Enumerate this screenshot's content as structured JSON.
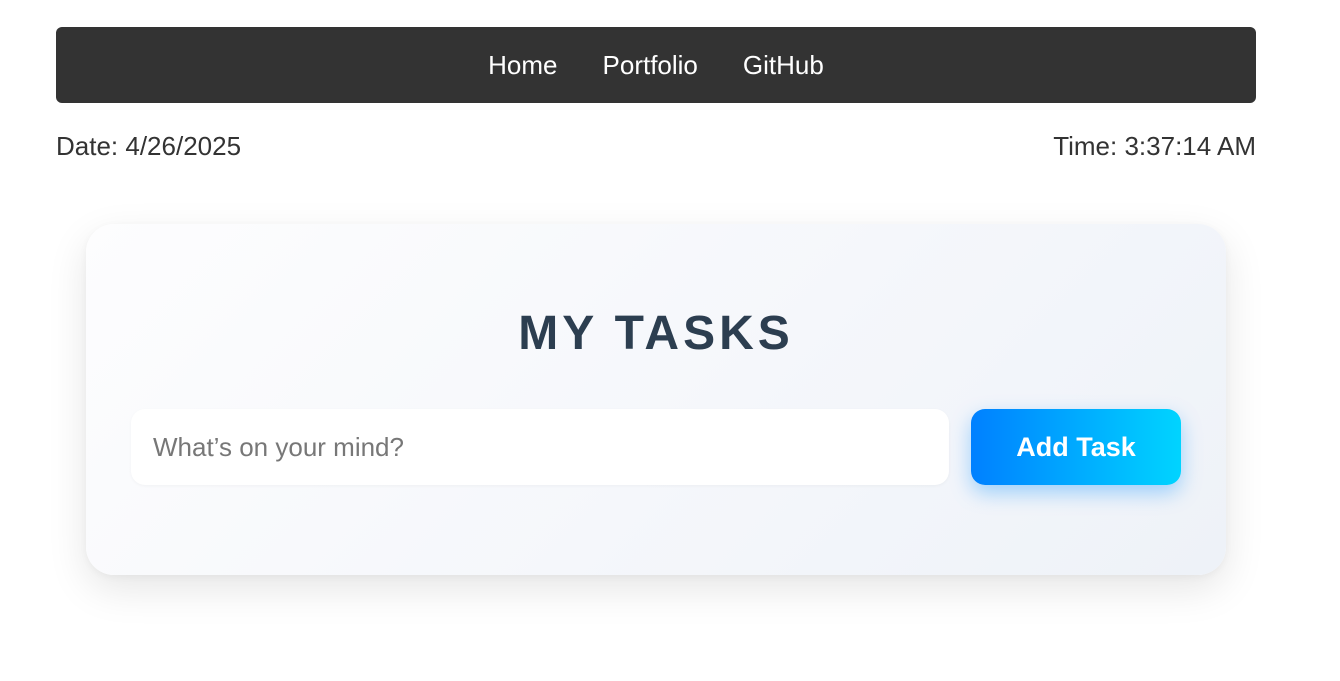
{
  "nav": {
    "links": [
      {
        "label": "Home"
      },
      {
        "label": "Portfolio"
      },
      {
        "label": "GitHub"
      }
    ]
  },
  "info": {
    "date_text": "Date: 4/26/2025",
    "time_text": "Time: 3:37:14 AM"
  },
  "card": {
    "title": "MY TASKS",
    "input": {
      "value": "",
      "placeholder": "What’s on your mind?"
    },
    "add_button_label": "Add Task"
  },
  "colors": {
    "navbar_bg": "#333333",
    "title": "#2c3e50",
    "button_gradient_start": "#0080ff",
    "button_gradient_end": "#00d4ff"
  }
}
